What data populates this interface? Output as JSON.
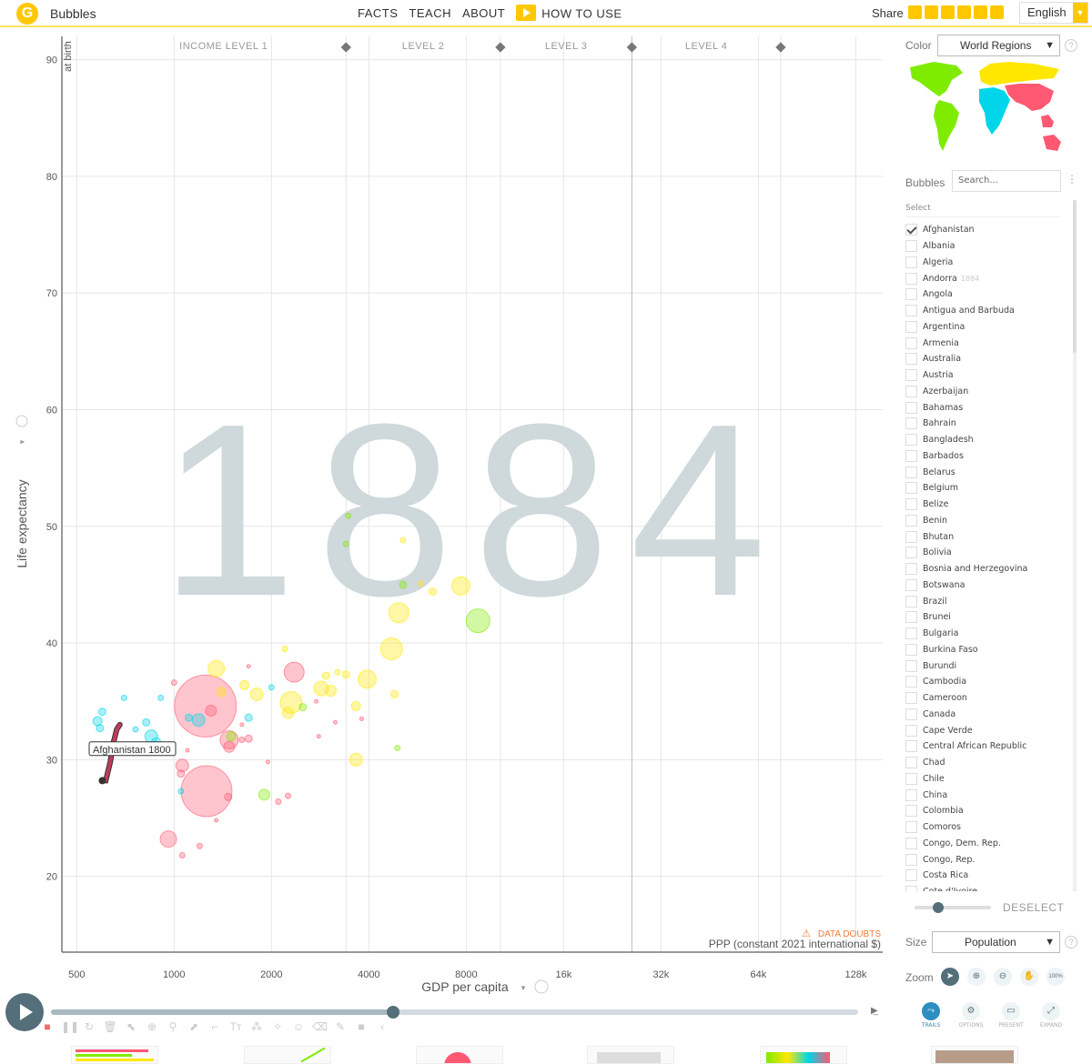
{
  "header": {
    "app_title": "Bubbles",
    "nav": [
      "FACTS",
      "TEACH",
      "ABOUT"
    ],
    "how_to_use": "HOW TO USE",
    "share": "Share",
    "language": "English"
  },
  "chart_data": {
    "type": "scatter",
    "year_watermark": "1884",
    "xlabel": "GDP per capita",
    "x_unit_label": "PPP (constant 2021 international $)",
    "ylabel": "Life expectancy",
    "ylabel_sub": "at birth",
    "x_scale": "log",
    "xlim": [
      450,
      155000
    ],
    "ylim": [
      13.5,
      92
    ],
    "x_ticks": [
      500,
      1000,
      2000,
      4000,
      8000,
      16000,
      32000,
      64000,
      128000
    ],
    "x_tick_labels": [
      "500",
      "1000",
      "2000",
      "4000",
      "8000",
      "16k",
      "32k",
      "64k",
      "128k"
    ],
    "y_ticks": [
      20,
      30,
      40,
      50,
      60,
      70,
      80,
      90
    ],
    "income_levels": [
      "INCOME LEVEL 1",
      "LEVEL 2",
      "LEVEL 3",
      "LEVEL 4"
    ],
    "income_boundaries": [
      3400,
      10200,
      26000,
      75000
    ],
    "data_doubts": "DATA DOUBTS",
    "trail": {
      "label": "Afghanistan 1800",
      "points": [
        [
          600,
          28.2
        ],
        [
          615,
          28.2
        ],
        [
          635,
          29.8
        ],
        [
          650,
          31.5
        ],
        [
          665,
          32.6
        ],
        [
          680,
          33.0
        ]
      ],
      "color": "#c23a5b"
    },
    "region_colors": {
      "asia": "#ff5872",
      "africa": "#00d5e9",
      "americas": "#7feb00",
      "europe": "#ffe700"
    },
    "bubbles": [
      [
        1250,
        34.6,
        34,
        "asia"
      ],
      [
        1260,
        27.3,
        28,
        "asia"
      ],
      [
        960,
        23.2,
        9,
        "asia"
      ],
      [
        2350,
        37.5,
        11,
        "asia"
      ],
      [
        1300,
        34.2,
        6,
        "asia"
      ],
      [
        1480,
        31.7,
        10,
        "asia"
      ],
      [
        1480,
        31.1,
        6,
        "asia"
      ],
      [
        1060,
        29.5,
        7,
        "asia"
      ],
      [
        1190,
        33.4,
        7,
        "africa"
      ],
      [
        1110,
        33.6,
        4,
        "africa"
      ],
      [
        1400,
        35.8,
        5,
        "europe"
      ],
      [
        1350,
        37.8,
        9,
        "europe"
      ],
      [
        1800,
        35.6,
        7,
        "europe"
      ],
      [
        1650,
        36.4,
        5,
        "europe"
      ],
      [
        2300,
        34.9,
        12,
        "europe"
      ],
      [
        2250,
        34.0,
        6,
        "europe"
      ],
      [
        2850,
        36.1,
        8,
        "europe"
      ],
      [
        3050,
        35.9,
        6,
        "europe"
      ],
      [
        3650,
        34.6,
        5,
        "europe"
      ],
      [
        3650,
        30.0,
        7,
        "europe"
      ],
      [
        3950,
        36.9,
        10,
        "europe"
      ],
      [
        4700,
        39.5,
        12,
        "europe"
      ],
      [
        4950,
        42.6,
        11,
        "europe"
      ],
      [
        7700,
        44.9,
        10,
        "europe"
      ],
      [
        3400,
        37.3,
        4,
        "europe"
      ],
      [
        2950,
        37.2,
        4,
        "europe"
      ],
      [
        4800,
        35.6,
        4,
        "europe"
      ],
      [
        6300,
        44.4,
        4,
        "europe"
      ],
      [
        5800,
        45.1,
        3,
        "europe"
      ],
      [
        5100,
        48.8,
        3,
        "europe"
      ],
      [
        2200,
        39.5,
        3,
        "europe"
      ],
      [
        3200,
        37.5,
        3,
        "europe"
      ],
      [
        8700,
        41.9,
        13,
        "americas"
      ],
      [
        1900,
        27.0,
        6,
        "americas"
      ],
      [
        5100,
        45.0,
        4,
        "americas"
      ],
      [
        4900,
        31.0,
        3,
        "americas"
      ],
      [
        3400,
        48.5,
        3,
        "americas"
      ],
      [
        3450,
        50.9,
        3,
        "americas"
      ],
      [
        1500,
        32.0,
        5,
        "americas"
      ],
      [
        2500,
        34.5,
        4,
        "americas"
      ],
      [
        820,
        33.2,
        4,
        "africa"
      ],
      [
        850,
        32.0,
        7,
        "africa"
      ],
      [
        880,
        31.5,
        5,
        "africa"
      ],
      [
        910,
        35.3,
        3,
        "africa"
      ],
      [
        580,
        33.3,
        5,
        "africa"
      ],
      [
        600,
        34.1,
        4,
        "africa"
      ],
      [
        590,
        32.7,
        4,
        "africa"
      ],
      [
        700,
        35.3,
        3,
        "africa"
      ],
      [
        760,
        32.6,
        3,
        "africa"
      ],
      [
        1700,
        33.6,
        4,
        "africa"
      ],
      [
        2000,
        36.2,
        3,
        "africa"
      ],
      [
        1050,
        27.3,
        3,
        "africa"
      ],
      [
        1000,
        36.6,
        3,
        "asia"
      ],
      [
        1700,
        31.8,
        4,
        "asia"
      ],
      [
        2100,
        26.4,
        3,
        "asia"
      ],
      [
        1620,
        31.7,
        3,
        "asia"
      ],
      [
        1050,
        28.8,
        4,
        "asia"
      ],
      [
        1470,
        26.8,
        4,
        "asia"
      ],
      [
        1060,
        21.8,
        3,
        "asia"
      ],
      [
        1200,
        22.6,
        3,
        "asia"
      ],
      [
        2250,
        26.9,
        3,
        "asia"
      ],
      [
        3150,
        33.2,
        2,
        "asia"
      ],
      [
        1700,
        38.0,
        2,
        "asia"
      ],
      [
        2800,
        32.0,
        2,
        "asia"
      ],
      [
        750,
        30.5,
        2,
        "asia"
      ],
      [
        1100,
        30.8,
        2,
        "asia"
      ],
      [
        1950,
        29.8,
        2,
        "asia"
      ],
      [
        2750,
        35.0,
        2,
        "asia"
      ],
      [
        3800,
        33.5,
        2,
        "asia"
      ],
      [
        1350,
        24.8,
        2,
        "asia"
      ],
      [
        1620,
        33.0,
        2,
        "asia"
      ]
    ]
  },
  "sidebar": {
    "color_label": "Color",
    "color_value": "World Regions",
    "bubbles_label": "Bubbles",
    "search_placeholder": "Search...",
    "select_header": "Select",
    "items": [
      {
        "name": "Afghanistan",
        "checked": true,
        "year": ""
      },
      {
        "name": "Albania",
        "checked": false,
        "year": ""
      },
      {
        "name": "Algeria",
        "checked": false,
        "year": ""
      },
      {
        "name": "Andorra",
        "checked": false,
        "year": "1884"
      },
      {
        "name": "Angola",
        "checked": false,
        "year": ""
      },
      {
        "name": "Antigua and Barbuda",
        "checked": false,
        "year": ""
      },
      {
        "name": "Argentina",
        "checked": false,
        "year": ""
      },
      {
        "name": "Armenia",
        "checked": false,
        "year": ""
      },
      {
        "name": "Australia",
        "checked": false,
        "year": ""
      },
      {
        "name": "Austria",
        "checked": false,
        "year": ""
      },
      {
        "name": "Azerbaijan",
        "checked": false,
        "year": ""
      },
      {
        "name": "Bahamas",
        "checked": false,
        "year": ""
      },
      {
        "name": "Bahrain",
        "checked": false,
        "year": ""
      },
      {
        "name": "Bangladesh",
        "checked": false,
        "year": ""
      },
      {
        "name": "Barbados",
        "checked": false,
        "year": ""
      },
      {
        "name": "Belarus",
        "checked": false,
        "year": ""
      },
      {
        "name": "Belgium",
        "checked": false,
        "year": ""
      },
      {
        "name": "Belize",
        "checked": false,
        "year": ""
      },
      {
        "name": "Benin",
        "checked": false,
        "year": ""
      },
      {
        "name": "Bhutan",
        "checked": false,
        "year": ""
      },
      {
        "name": "Bolivia",
        "checked": false,
        "year": ""
      },
      {
        "name": "Bosnia and Herzegovina",
        "checked": false,
        "year": ""
      },
      {
        "name": "Botswana",
        "checked": false,
        "year": ""
      },
      {
        "name": "Brazil",
        "checked": false,
        "year": ""
      },
      {
        "name": "Brunei",
        "checked": false,
        "year": ""
      },
      {
        "name": "Bulgaria",
        "checked": false,
        "year": ""
      },
      {
        "name": "Burkina Faso",
        "checked": false,
        "year": ""
      },
      {
        "name": "Burundi",
        "checked": false,
        "year": ""
      },
      {
        "name": "Cambodia",
        "checked": false,
        "year": ""
      },
      {
        "name": "Cameroon",
        "checked": false,
        "year": ""
      },
      {
        "name": "Canada",
        "checked": false,
        "year": ""
      },
      {
        "name": "Cape Verde",
        "checked": false,
        "year": ""
      },
      {
        "name": "Central African Republic",
        "checked": false,
        "year": ""
      },
      {
        "name": "Chad",
        "checked": false,
        "year": ""
      },
      {
        "name": "Chile",
        "checked": false,
        "year": ""
      },
      {
        "name": "China",
        "checked": false,
        "year": ""
      },
      {
        "name": "Colombia",
        "checked": false,
        "year": ""
      },
      {
        "name": "Comoros",
        "checked": false,
        "year": ""
      },
      {
        "name": "Congo, Dem. Rep.",
        "checked": false,
        "year": ""
      },
      {
        "name": "Congo, Rep.",
        "checked": false,
        "year": ""
      },
      {
        "name": "Costa Rica",
        "checked": false,
        "year": ""
      },
      {
        "name": "Cote d'Ivoire",
        "checked": false,
        "year": ""
      }
    ],
    "deselect": "DESELECT",
    "size_label": "Size",
    "size_value": "Population",
    "zoom_label": "Zoom",
    "zoom_level": "100%",
    "tools": [
      "TRAILS",
      "OPTIONS",
      "PRESENT",
      "EXPAND"
    ]
  },
  "timeline": {
    "progress": 0.424
  }
}
